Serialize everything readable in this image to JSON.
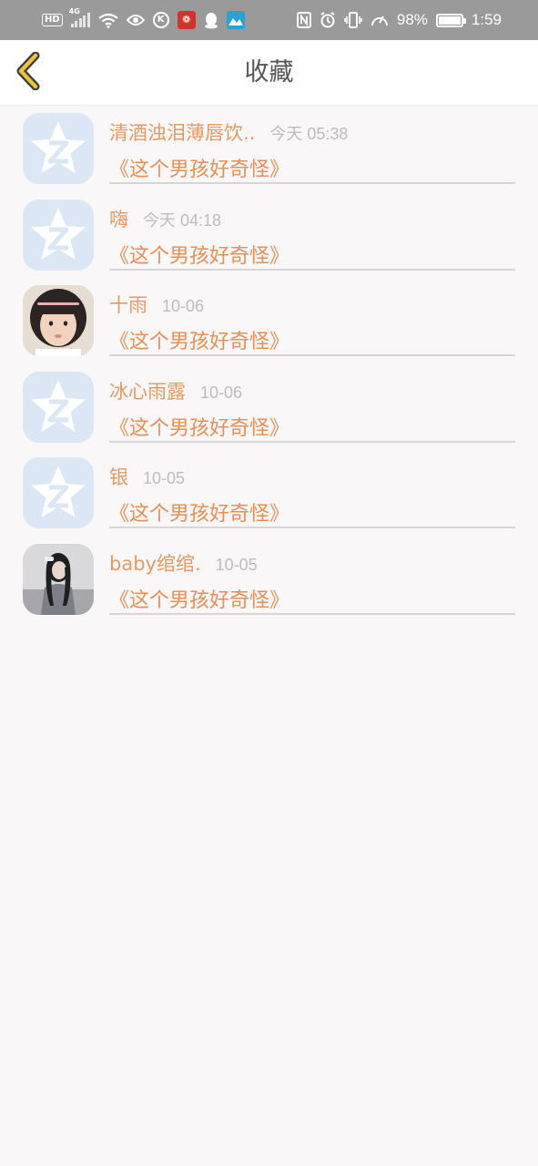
{
  "status_bar": {
    "hd": "HD",
    "network": "4G",
    "battery": "98%",
    "time": "1:59",
    "icons": [
      "hd-icon",
      "signal-icon",
      "wifi-icon",
      "eye-icon",
      "k-icon",
      "app-red-icon",
      "qq-icon",
      "app-blue-icon",
      "nfc-icon",
      "alarm-icon",
      "vibrate-icon",
      "speed-icon",
      "battery-icon"
    ]
  },
  "header": {
    "title": "收藏",
    "back_icon": "chevron-left-icon",
    "accent": "#e8c23a"
  },
  "items": [
    {
      "name": "清酒浊泪薄唇饮..",
      "time": "今天 05:38",
      "title": "《这个男孩好奇怪》",
      "avatar": "default-star"
    },
    {
      "name": "嗨",
      "time": "今天 04:18",
      "title": "《这个男孩好奇怪》",
      "avatar": "default-star"
    },
    {
      "name": "十雨",
      "time": "10-06",
      "title": "《这个男孩好奇怪》",
      "avatar": "photo-girl"
    },
    {
      "name": "冰心雨露",
      "time": "10-06",
      "title": "《这个男孩好奇怪》",
      "avatar": "default-star"
    },
    {
      "name": "银",
      "time": "10-05",
      "title": "《这个男孩好奇怪》",
      "avatar": "default-star"
    },
    {
      "name": "baby绾绾.",
      "time": "10-05",
      "title": "《这个男孩好奇怪》",
      "avatar": "photo-woman"
    }
  ],
  "colors": {
    "name": "#e59a63",
    "title": "#e88f55",
    "time": "#bdbdbd",
    "background": "#f9f7f8"
  }
}
